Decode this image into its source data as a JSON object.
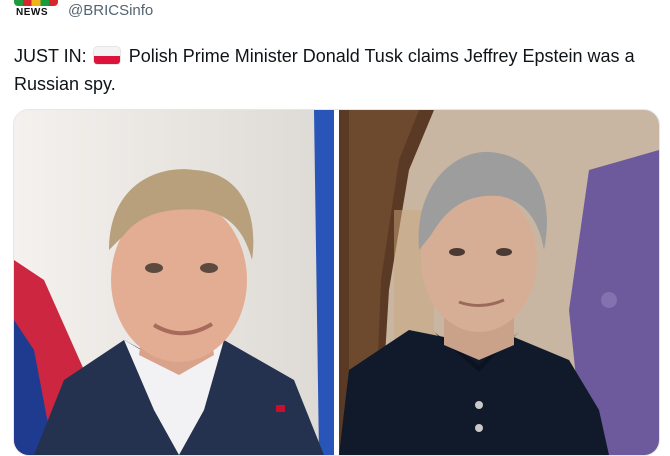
{
  "account": {
    "logo_text": "NEWS",
    "handle": "@BRICSinfo"
  },
  "tweet": {
    "prefix": "JUST IN:",
    "flag": "poland-flag-emoji",
    "body": "Polish Prime Minister Donald Tusk claims Jeffrey Epstein was a Russian spy."
  },
  "media": {
    "images": [
      {
        "subject": "Donald Tusk portrait"
      },
      {
        "subject": "Jeffrey Epstein portrait"
      }
    ]
  }
}
